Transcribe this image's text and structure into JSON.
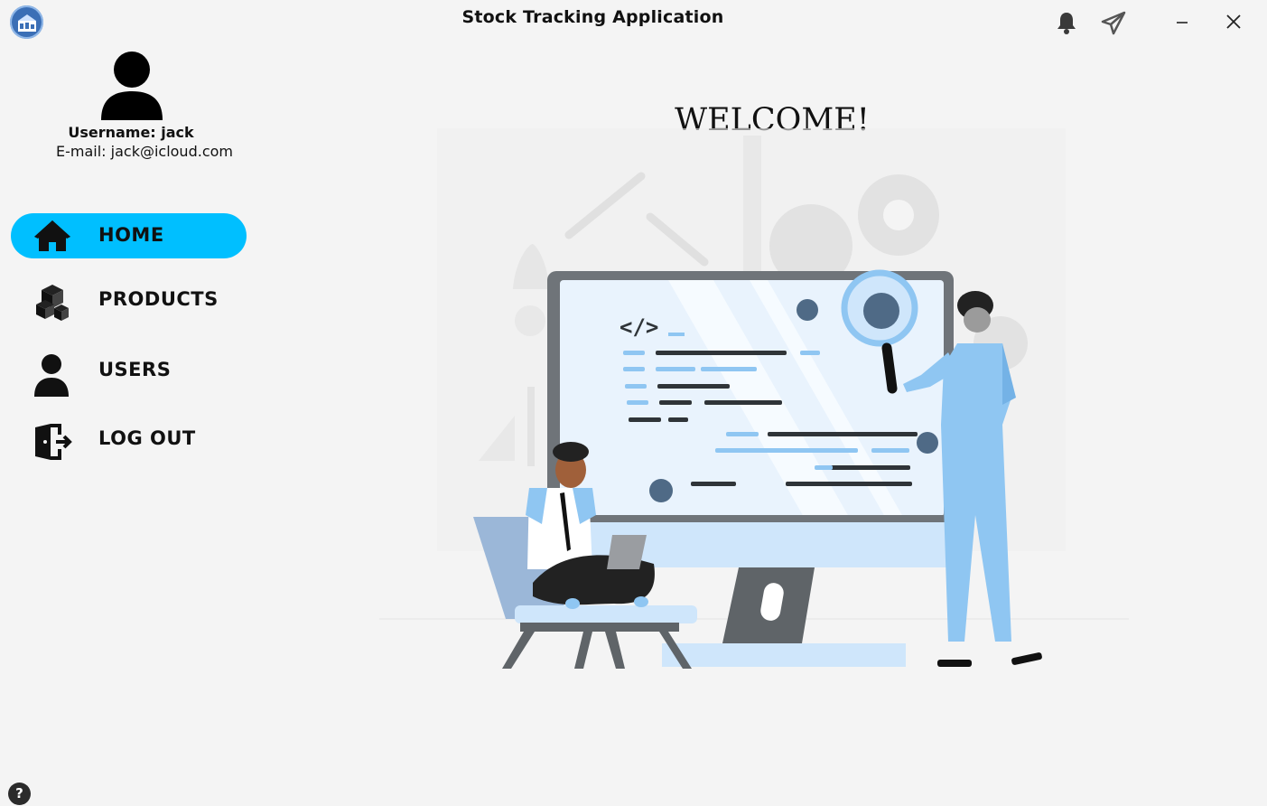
{
  "window": {
    "title": "Stock Tracking Application"
  },
  "profile": {
    "username_line": "Username: jack",
    "email_line": "E-mail: jack@icloud.com"
  },
  "nav": {
    "items": [
      {
        "label": "HOME",
        "icon": "home-icon",
        "active": true
      },
      {
        "label": "PRODUCTS",
        "icon": "boxes-icon",
        "active": false
      },
      {
        "label": "USERS",
        "icon": "user-icon",
        "active": false
      },
      {
        "label": "LOG OUT",
        "icon": "logout-icon",
        "active": false
      }
    ]
  },
  "main": {
    "welcome": "WELCOME!",
    "illustration_code_tag": "</>"
  },
  "help": {
    "label": "?"
  },
  "colors": {
    "accent": "#00bfff",
    "background": "#f4f4f4",
    "illustration_blue": "#8fc6f2"
  }
}
